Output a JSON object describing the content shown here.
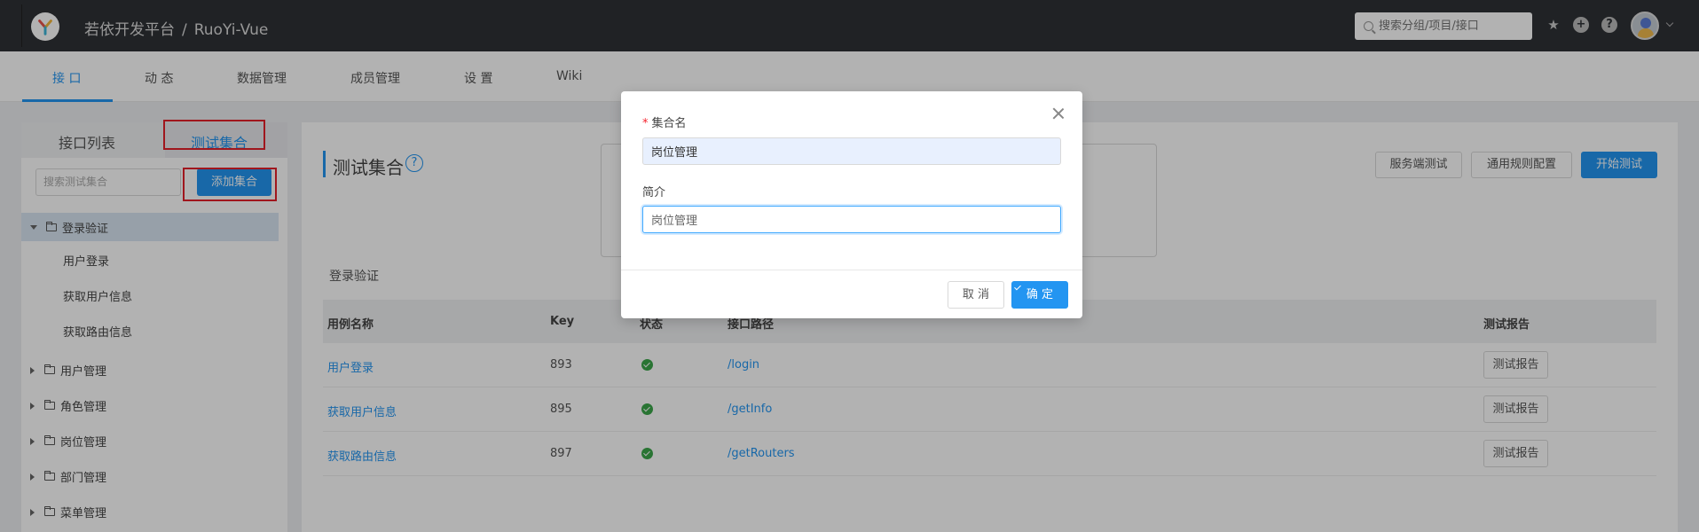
{
  "header": {
    "app_name": "若依开发平台",
    "separator": "/",
    "project": "RuoYi-Vue",
    "search_placeholder": "搜索分组/项目/接口"
  },
  "nav": {
    "tabs": [
      {
        "label": "接 口"
      },
      {
        "label": "动 态"
      },
      {
        "label": "数据管理"
      },
      {
        "label": "成员管理"
      },
      {
        "label": "设 置"
      },
      {
        "label": "Wiki"
      }
    ]
  },
  "sidebar": {
    "tab_api_list": "接口列表",
    "tab_test_collection": "测试集合",
    "search_placeholder": "搜索测试集合",
    "add_button": "添加集合",
    "tree": [
      {
        "label": "登录验证",
        "expanded": true
      },
      {
        "label": "用户登录"
      },
      {
        "label": "获取用户信息"
      },
      {
        "label": "获取路由信息"
      },
      {
        "label": "用户管理"
      },
      {
        "label": "角色管理"
      },
      {
        "label": "岗位管理"
      },
      {
        "label": "部门管理"
      },
      {
        "label": "菜单管理"
      }
    ]
  },
  "main": {
    "title": "测试集合",
    "help_icon": "?",
    "buttons": {
      "server_test": "服务端测试",
      "rules_config": "通用规则配置",
      "start_test": "开始测试"
    },
    "section": "登录验证",
    "columns": [
      "用例名称",
      "Key",
      "状态",
      "接口路径",
      "测试报告"
    ],
    "rows": [
      {
        "name": "用户登录",
        "key": "893",
        "path": "/login",
        "report": "测试报告"
      },
      {
        "name": "获取用户信息",
        "key": "895",
        "path": "/getInfo",
        "report": "测试报告"
      },
      {
        "name": "获取路由信息",
        "key": "897",
        "path": "/getRouters",
        "report": "测试报告"
      }
    ]
  },
  "modal": {
    "required_mark": "*",
    "name_label": "集合名",
    "name_value": "岗位管理",
    "desc_label": "简介",
    "desc_value": "岗位管理",
    "cancel": "取 消",
    "confirm": "确 定"
  },
  "colors": {
    "accent": "#2395f1",
    "header_bg": "#2f3236",
    "success": "#3ba64a",
    "highlight": "#e5202a"
  }
}
